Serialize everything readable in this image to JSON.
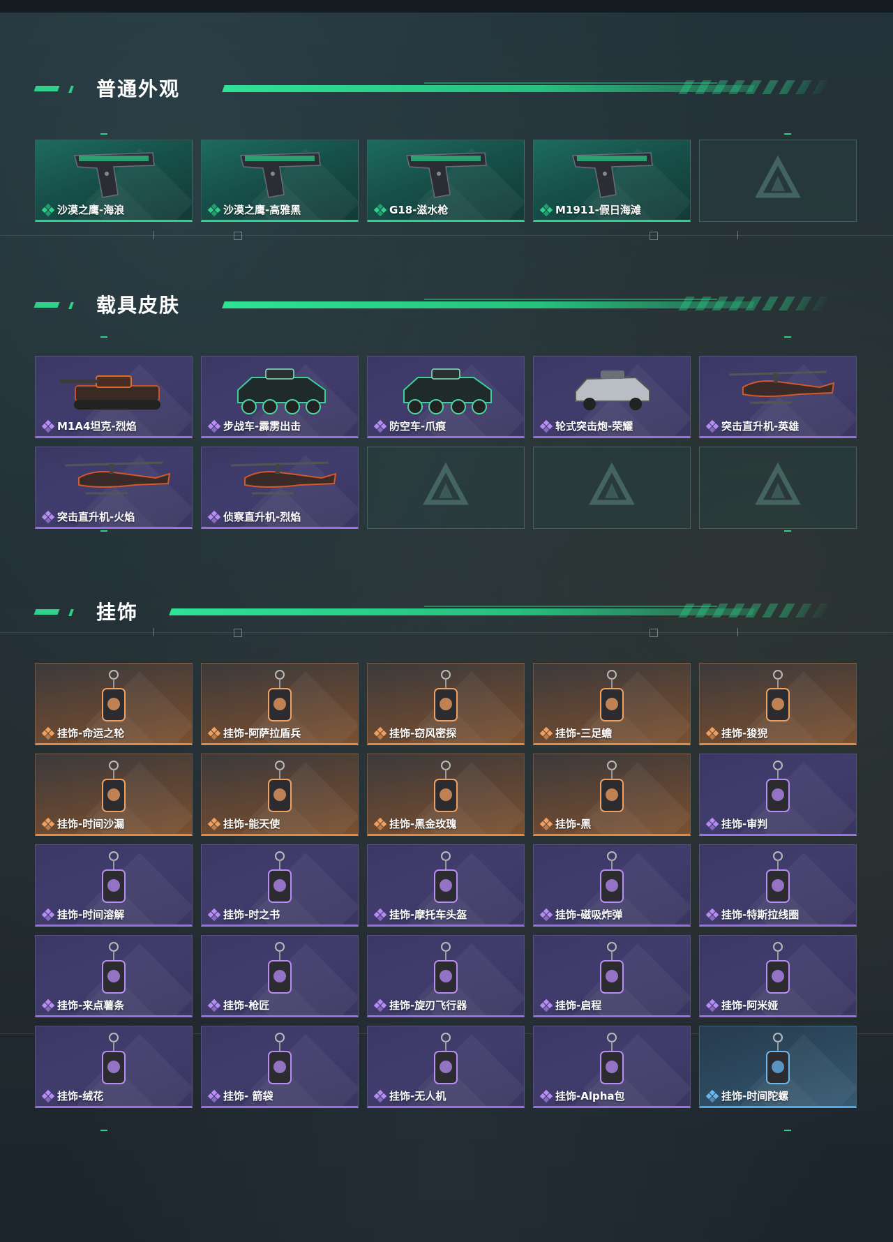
{
  "sections": [
    {
      "title": "普通外观",
      "items": [
        {
          "label": "沙漠之鹰-海浪",
          "rarity": "green",
          "icon": "pistol-icon"
        },
        {
          "label": "沙漠之鹰-高雅黑",
          "rarity": "green",
          "icon": "pistol-icon"
        },
        {
          "label": "G18-滋水枪",
          "rarity": "green",
          "icon": "pistol-icon"
        },
        {
          "label": "M1911-假日海滩",
          "rarity": "green",
          "icon": "pistol-icon"
        },
        {
          "label": "",
          "rarity": "empty",
          "icon": "placeholder-logo-icon"
        }
      ]
    },
    {
      "title": "载具皮肤",
      "items": [
        {
          "label": "M1A4坦克-烈焰",
          "rarity": "purple",
          "icon": "tank-icon"
        },
        {
          "label": "步战车-霹雳出击",
          "rarity": "purple",
          "icon": "armored-vehicle-icon"
        },
        {
          "label": "防空车-爪痕",
          "rarity": "purple",
          "icon": "armored-vehicle-icon"
        },
        {
          "label": "轮式突击炮-荣耀",
          "rarity": "purple",
          "icon": "armored-car-icon"
        },
        {
          "label": "突击直升机-英雄",
          "rarity": "purple",
          "icon": "helicopter-icon"
        },
        {
          "label": "突击直升机-火焰",
          "rarity": "purple",
          "icon": "helicopter-icon"
        },
        {
          "label": "侦察直升机-烈焰",
          "rarity": "purple",
          "icon": "helicopter-icon"
        },
        {
          "label": "",
          "rarity": "empty",
          "icon": "placeholder-logo-icon"
        },
        {
          "label": "",
          "rarity": "empty",
          "icon": "placeholder-logo-icon"
        },
        {
          "label": "",
          "rarity": "empty",
          "icon": "placeholder-logo-icon"
        }
      ]
    },
    {
      "title": "挂饰",
      "items": [
        {
          "label": "挂饰-命运之轮",
          "rarity": "orange",
          "icon": "charm-icon"
        },
        {
          "label": "挂饰-阿萨拉盾兵",
          "rarity": "orange",
          "icon": "charm-icon"
        },
        {
          "label": "挂饰-窃风密探",
          "rarity": "orange",
          "icon": "charm-icon"
        },
        {
          "label": "挂饰-三足蟾",
          "rarity": "orange",
          "icon": "charm-icon"
        },
        {
          "label": "挂饰-狻猊",
          "rarity": "orange",
          "icon": "charm-icon"
        },
        {
          "label": "挂饰-时间沙漏",
          "rarity": "orange",
          "icon": "charm-icon"
        },
        {
          "label": "挂饰-能天使",
          "rarity": "orange",
          "icon": "charm-icon"
        },
        {
          "label": "挂饰-黑金玫瑰",
          "rarity": "orange",
          "icon": "charm-icon"
        },
        {
          "label": "挂饰-黑",
          "rarity": "orange",
          "icon": "charm-icon"
        },
        {
          "label": "挂饰-审判",
          "rarity": "purple",
          "icon": "charm-icon"
        },
        {
          "label": "挂饰-时间溶解",
          "rarity": "purple",
          "icon": "charm-icon"
        },
        {
          "label": "挂饰-时之书",
          "rarity": "purple",
          "icon": "charm-icon"
        },
        {
          "label": "挂饰-摩托车头盔",
          "rarity": "purple",
          "icon": "charm-icon"
        },
        {
          "label": "挂饰-磁吸炸弹",
          "rarity": "purple",
          "icon": "charm-icon"
        },
        {
          "label": "挂饰-特斯拉线圈",
          "rarity": "purple",
          "icon": "charm-icon"
        },
        {
          "label": "挂饰-来点薯条",
          "rarity": "purple",
          "icon": "charm-icon"
        },
        {
          "label": "挂饰-枪匠",
          "rarity": "purple",
          "icon": "charm-icon"
        },
        {
          "label": "挂饰-旋刃飞行器",
          "rarity": "purple",
          "icon": "charm-icon"
        },
        {
          "label": "挂饰-启程",
          "rarity": "purple",
          "icon": "charm-icon"
        },
        {
          "label": "挂饰-阿米娅",
          "rarity": "purple",
          "icon": "charm-icon"
        },
        {
          "label": "挂饰-绒花",
          "rarity": "purple",
          "icon": "charm-icon"
        },
        {
          "label": "挂饰- 箭袋",
          "rarity": "purple",
          "icon": "charm-icon"
        },
        {
          "label": "挂饰-无人机",
          "rarity": "purple",
          "icon": "charm-icon"
        },
        {
          "label": "挂饰-Alpha包",
          "rarity": "purple",
          "icon": "charm-icon"
        },
        {
          "label": "挂饰-时间陀螺",
          "rarity": "blue",
          "icon": "charm-icon"
        }
      ]
    }
  ],
  "colors": {
    "accent": "#2fd18a",
    "green_rarity": "#2fd18a",
    "purple_rarity": "#9a6fe0",
    "orange_rarity": "#e08a48",
    "blue_rarity": "#4fa8e6"
  }
}
